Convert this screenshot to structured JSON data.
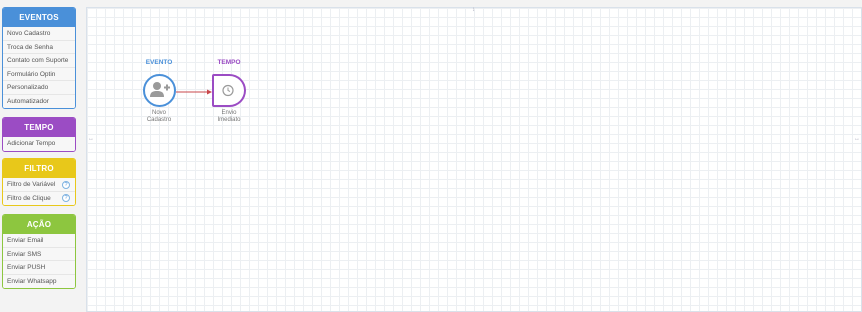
{
  "sidebar": {
    "eventos": {
      "title": "EVENTOS",
      "items": [
        "Novo Cadastro",
        "Troca de Senha",
        "Contato com Suporte",
        "Formulário Optin",
        "Personalizado",
        "Automatizador"
      ]
    },
    "tempo": {
      "title": "TEMPO",
      "items": [
        "Adicionar Tempo"
      ]
    },
    "filtro": {
      "title": "FILTRO",
      "items": [
        "Filtro de Variável",
        "Filtro de Clique"
      ],
      "help": "?"
    },
    "acao": {
      "title": "AÇÃO",
      "items": [
        "Enviar Email",
        "Enviar SMS",
        "Enviar PUSH",
        "Enviar Whatsapp"
      ]
    }
  },
  "canvas": {
    "nodes": {
      "event": {
        "title": "EVENTO",
        "label_line1": "Novo",
        "label_line2": "Cadastro",
        "icon": "user-plus-icon"
      },
      "time": {
        "title": "TEMPO",
        "label_line1": "Envio",
        "label_line2": "Imediato",
        "icon": "clock-icon"
      }
    }
  },
  "colors": {
    "eventos": "#4a90d9",
    "tempo": "#9b4cc4",
    "filtro": "#e8c81a",
    "acao": "#8dc63f",
    "connector": "#c9474b"
  }
}
